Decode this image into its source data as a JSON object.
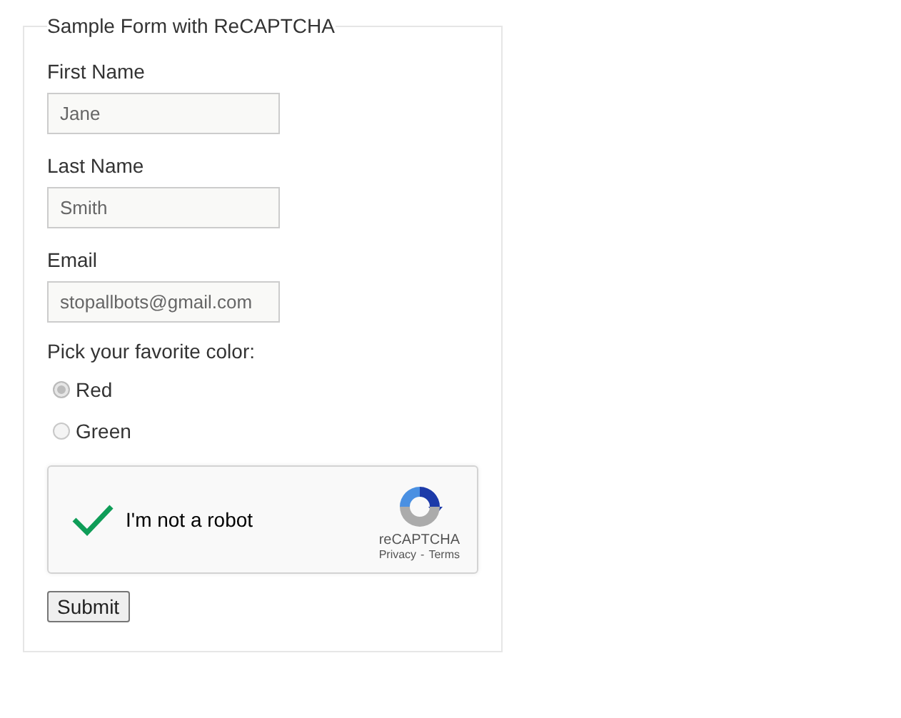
{
  "form": {
    "legend": "Sample Form with ReCAPTCHA",
    "fields": [
      {
        "label": "First Name",
        "value": "Jane"
      },
      {
        "label": "Last Name",
        "value": "Smith"
      },
      {
        "label": "Email",
        "value": "stopallbots@gmail.com"
      }
    ],
    "color_question": {
      "label": "Pick your favorite color:",
      "options": [
        {
          "label": "Red",
          "selected": true
        },
        {
          "label": "Green",
          "selected": false
        }
      ]
    },
    "captcha": {
      "checked": true,
      "label": "I'm not a robot",
      "brand": "reCAPTCHA",
      "links": [
        "Privacy",
        "Terms"
      ],
      "separator": "-"
    },
    "submit": "Submit"
  }
}
